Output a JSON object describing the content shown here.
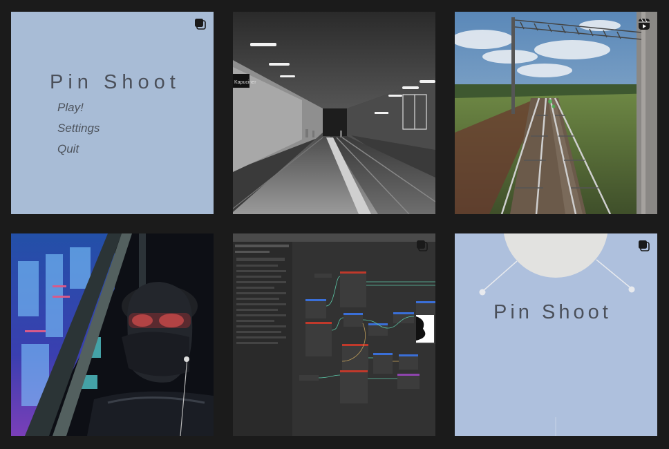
{
  "grid": {
    "tiles": [
      {
        "id": "t1",
        "kind": "game-menu",
        "badge": "multi-image-icon"
      },
      {
        "id": "t2",
        "kind": "photo-metro-platform"
      },
      {
        "id": "t3",
        "kind": "photo-railway",
        "badge": "reel-icon"
      },
      {
        "id": "t4",
        "kind": "photo-night-window"
      },
      {
        "id": "t5",
        "kind": "editor-screenshot",
        "badge": "multi-image-icon"
      },
      {
        "id": "t6",
        "kind": "game-title",
        "badge": "multi-image-icon"
      }
    ]
  },
  "menu_tile": {
    "title": "Pin Shoot",
    "items": [
      "Play!",
      "Settings",
      "Quit"
    ]
  },
  "metro_tile": {
    "sign_text": "Kapuciner"
  },
  "title_tile": {
    "title": "Pin Shoot"
  },
  "colors": {
    "page_bg": "#1b1b1b",
    "menu_bg": "#a8bcd6",
    "title_bg": "#aec0dd",
    "menu_text": "#4d535c"
  }
}
